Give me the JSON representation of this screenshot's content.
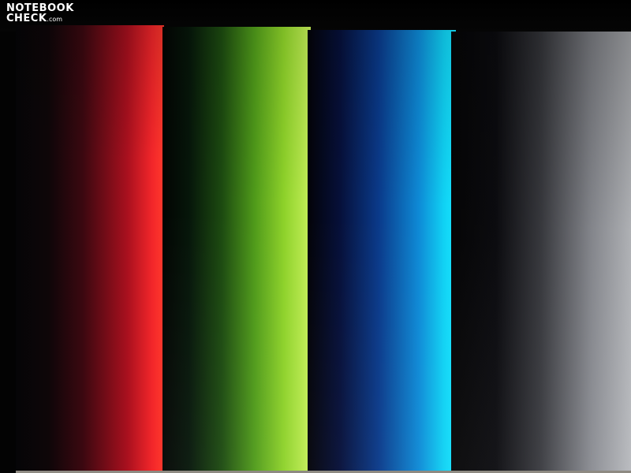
{
  "watermark": {
    "line1": "NOTEBOOK",
    "line2": "CHECK",
    "suffix": ".com"
  },
  "bars": [
    {
      "name": "red",
      "color": "#ff3a2c"
    },
    {
      "name": "green",
      "color": "#c6f05a"
    },
    {
      "name": "blue",
      "color": "#18e4ff"
    },
    {
      "name": "gray",
      "color": "#b8babe"
    }
  ]
}
